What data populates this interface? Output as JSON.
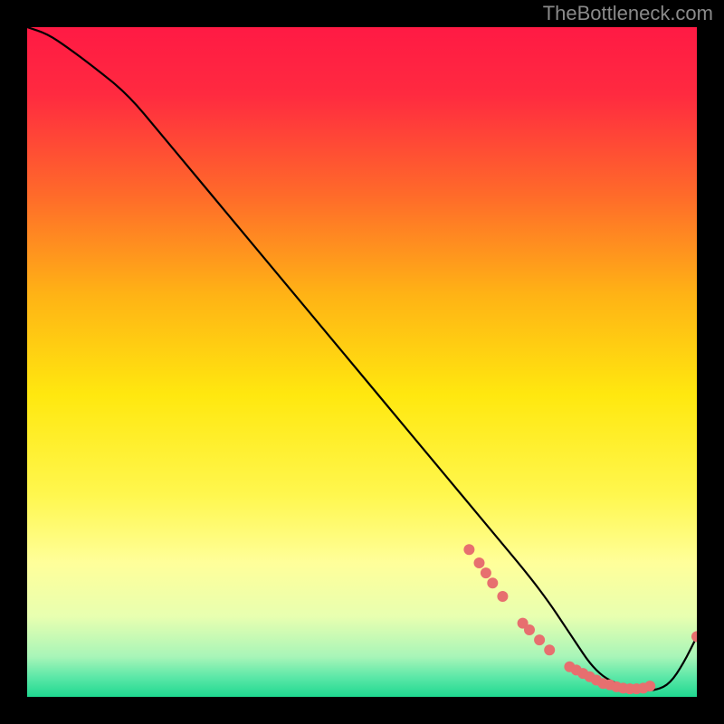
{
  "watermark": "TheBottleneck.com",
  "chart_data": {
    "type": "line",
    "title": "",
    "xlabel": "",
    "ylabel": "",
    "xlim": [
      0,
      100
    ],
    "ylim": [
      0,
      100
    ],
    "gradient_stops": [
      {
        "offset": 0.0,
        "color": "#ff1a44"
      },
      {
        "offset": 0.1,
        "color": "#ff2a40"
      },
      {
        "offset": 0.25,
        "color": "#ff6a2a"
      },
      {
        "offset": 0.4,
        "color": "#ffb315"
      },
      {
        "offset": 0.55,
        "color": "#ffe80f"
      },
      {
        "offset": 0.7,
        "color": "#fff74f"
      },
      {
        "offset": 0.8,
        "color": "#ffff9a"
      },
      {
        "offset": 0.88,
        "color": "#e8ffb0"
      },
      {
        "offset": 0.94,
        "color": "#a8f5b8"
      },
      {
        "offset": 0.97,
        "color": "#5de8a8"
      },
      {
        "offset": 1.0,
        "color": "#1fd890"
      }
    ],
    "series": [
      {
        "name": "bottleneck-curve",
        "x": [
          0,
          3,
          6,
          10,
          15,
          20,
          25,
          30,
          35,
          40,
          45,
          50,
          55,
          60,
          65,
          70,
          75,
          78,
          80,
          82,
          84,
          86,
          88,
          90,
          92,
          94,
          96,
          98,
          100
        ],
        "y": [
          100,
          99,
          97,
          94,
          90,
          84,
          78,
          72,
          66,
          60,
          54,
          48,
          42,
          36,
          30,
          24,
          18,
          14,
          11,
          8,
          5,
          3,
          2,
          1,
          1,
          1,
          2,
          5,
          9
        ]
      }
    ],
    "markers": [
      {
        "x": 66.0,
        "y": 22.0
      },
      {
        "x": 67.5,
        "y": 20.0
      },
      {
        "x": 68.5,
        "y": 18.5
      },
      {
        "x": 69.5,
        "y": 17.0
      },
      {
        "x": 71.0,
        "y": 15.0
      },
      {
        "x": 74.0,
        "y": 11.0
      },
      {
        "x": 75.0,
        "y": 10.0
      },
      {
        "x": 76.5,
        "y": 8.5
      },
      {
        "x": 78.0,
        "y": 7.0
      },
      {
        "x": 81.0,
        "y": 4.5
      },
      {
        "x": 82.0,
        "y": 4.0
      },
      {
        "x": 83.0,
        "y": 3.5
      },
      {
        "x": 84.0,
        "y": 3.0
      },
      {
        "x": 85.0,
        "y": 2.5
      },
      {
        "x": 86.0,
        "y": 2.0
      },
      {
        "x": 87.0,
        "y": 1.8
      },
      {
        "x": 88.0,
        "y": 1.5
      },
      {
        "x": 89.0,
        "y": 1.3
      },
      {
        "x": 90.0,
        "y": 1.2
      },
      {
        "x": 91.0,
        "y": 1.2
      },
      {
        "x": 92.0,
        "y": 1.3
      },
      {
        "x": 93.0,
        "y": 1.6
      },
      {
        "x": 100.0,
        "y": 9.0
      }
    ],
    "marker_color": "#e76f6f",
    "marker_radius": 6
  }
}
